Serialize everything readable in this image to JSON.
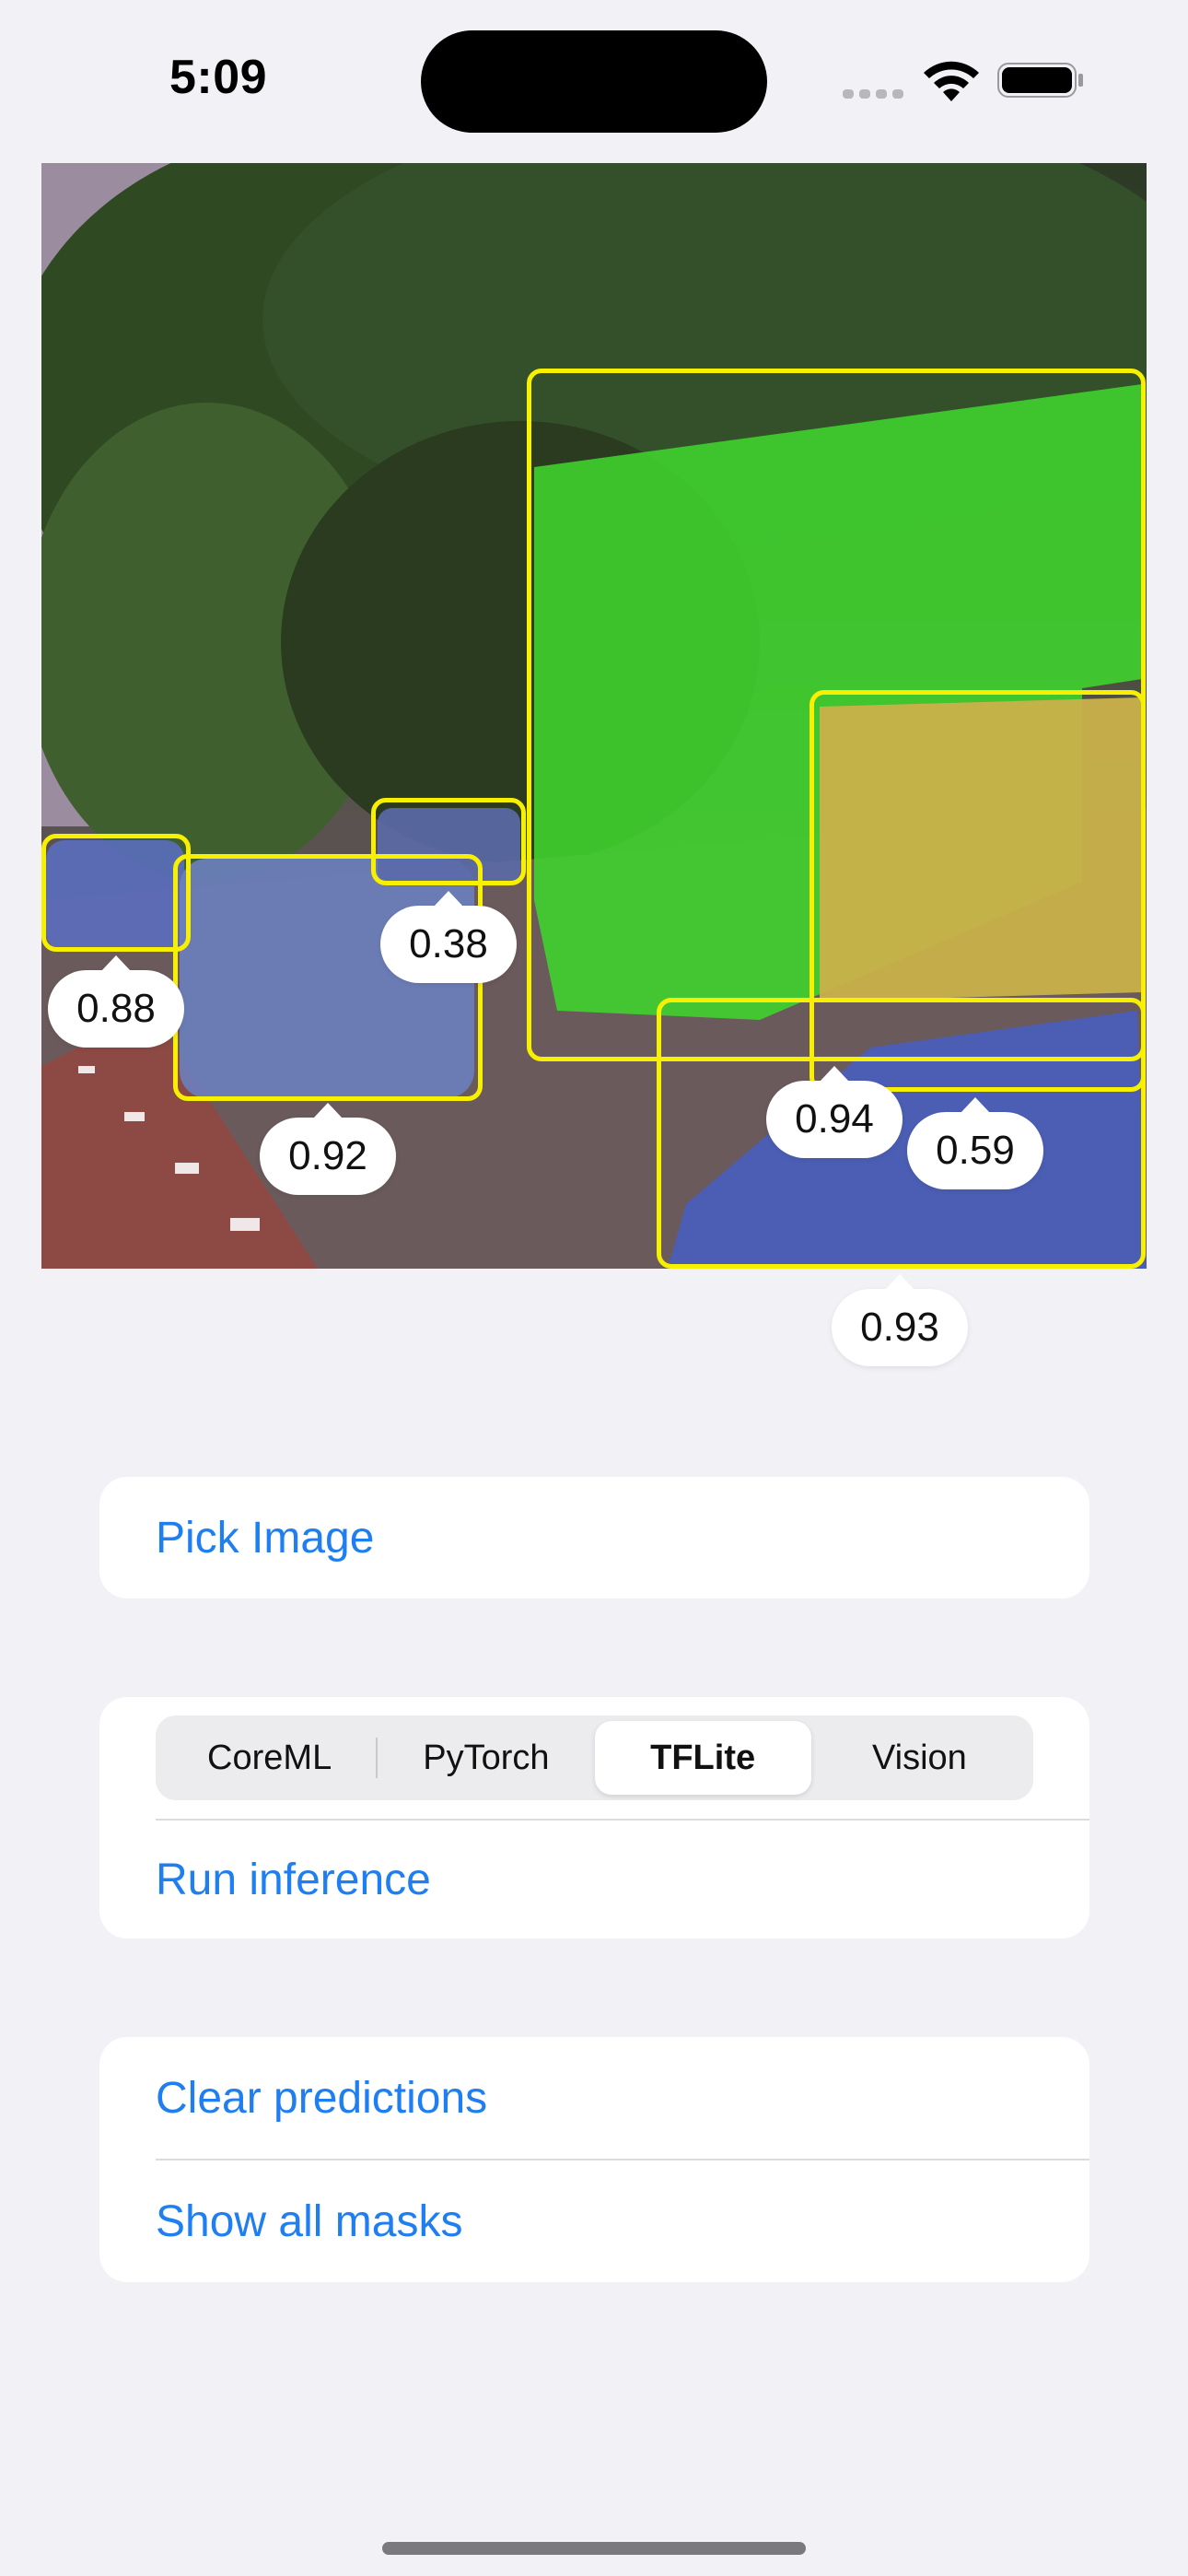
{
  "status_bar": {
    "time": "5:09"
  },
  "detections": [
    {
      "label_icon": "car",
      "score": "0.88",
      "mask_color": "#5b6fc4"
    },
    {
      "label_icon": "car",
      "score": "0.92",
      "mask_color": "#5b6fc4"
    },
    {
      "label_icon": "car",
      "score": "0.38",
      "mask_color": "#5b6fc4"
    },
    {
      "label_icon": "bus",
      "score": "0.94",
      "mask_color": "#3fd12e"
    },
    {
      "label_icon": "truck",
      "score": "0.59",
      "mask_color": "#c9b14a"
    },
    {
      "label_icon": "car",
      "score": "0.93",
      "mask_color": "#4a5fb8"
    }
  ],
  "pick_card": {
    "pick_image_label": "Pick Image"
  },
  "inference_card": {
    "segments": [
      "CoreML",
      "PyTorch",
      "TFLite",
      "Vision"
    ],
    "selected_segment": "TFLite",
    "run_label": "Run inference"
  },
  "actions_card": {
    "clear_label": "Clear predictions",
    "show_masks_label": "Show all masks"
  },
  "colors": {
    "accent": "#1f7ef0",
    "box_outline": "#f7f000",
    "background": "#f2f1f6"
  }
}
